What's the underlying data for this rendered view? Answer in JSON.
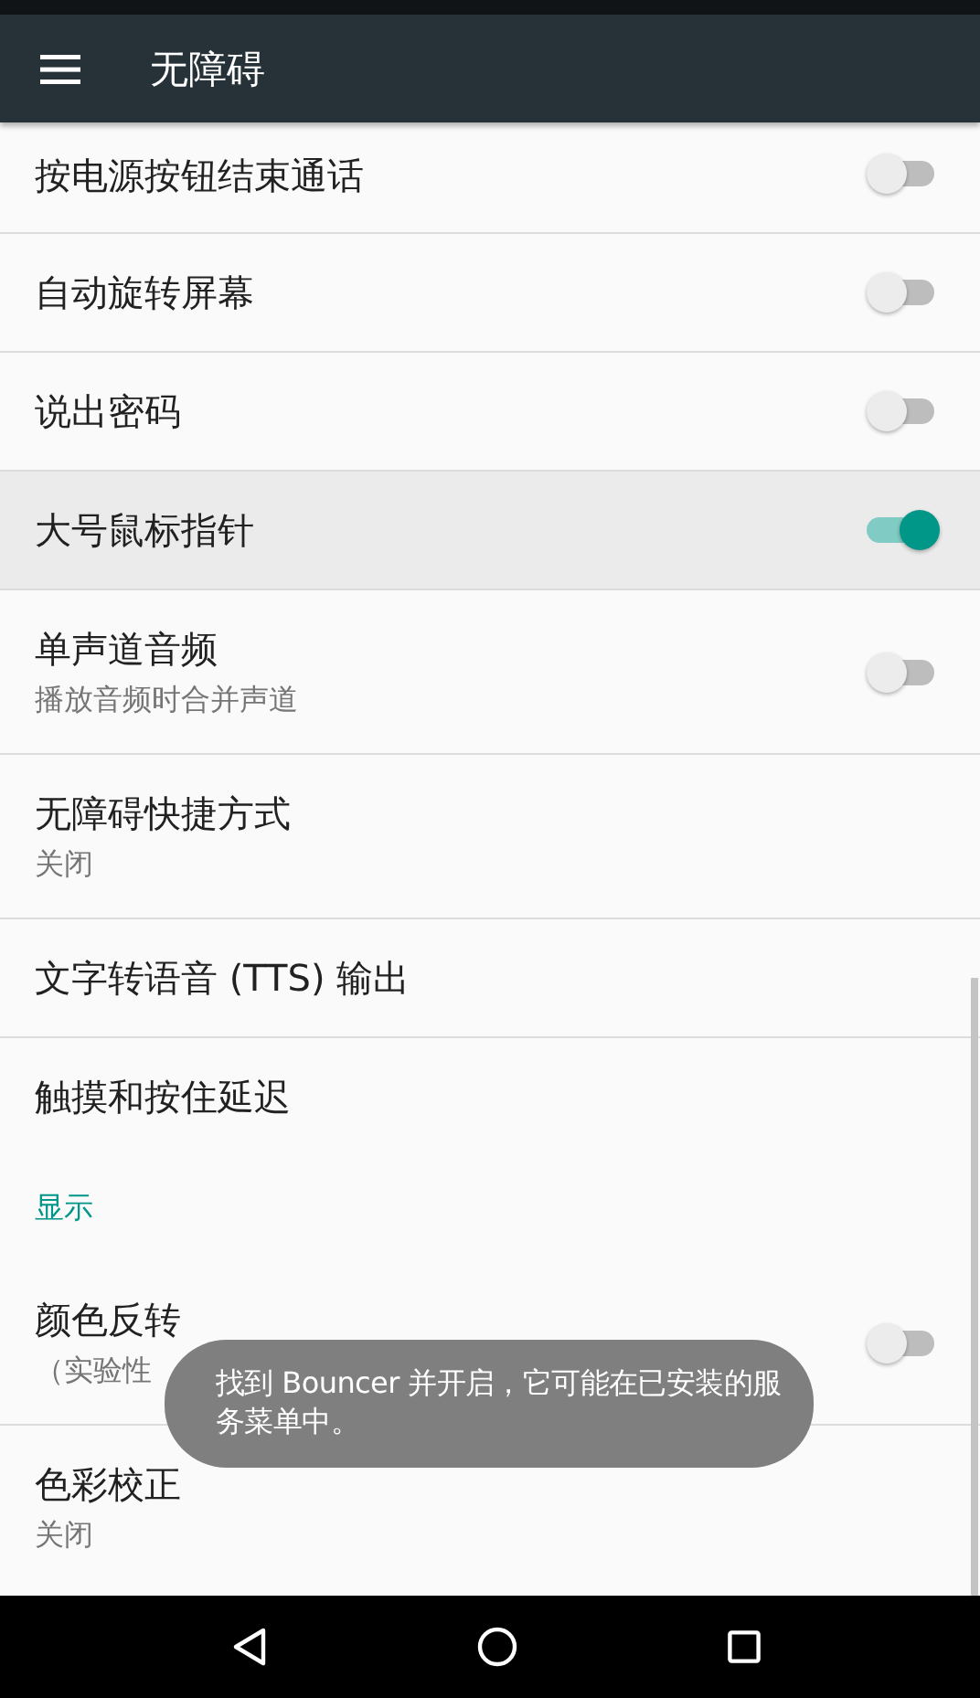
{
  "app_bar": {
    "title": "无障碍"
  },
  "items": [
    {
      "kind": "switch",
      "title": "按电源按钮结束通话",
      "on": false,
      "selected": false
    },
    {
      "kind": "switch",
      "title": "自动旋转屏幕",
      "on": false,
      "selected": false
    },
    {
      "kind": "switch",
      "title": "说出密码",
      "on": false,
      "selected": false
    },
    {
      "kind": "switch",
      "title": "大号鼠标指针",
      "on": true,
      "selected": true
    },
    {
      "kind": "switch",
      "title": "单声道音频",
      "subtitle": "播放音频时合并声道",
      "on": false,
      "selected": false
    },
    {
      "kind": "text",
      "title": "无障碍快捷方式",
      "subtitle": "关闭",
      "selected": false
    },
    {
      "kind": "text",
      "title": "文字转语音 (TTS) 输出",
      "selected": false
    },
    {
      "kind": "text",
      "title": "触摸和按住延迟",
      "selected": false
    },
    {
      "kind": "header",
      "title": "显示"
    },
    {
      "kind": "switch",
      "title": "颜色反转",
      "subtitle": "（实验性",
      "on": false,
      "selected": false
    },
    {
      "kind": "text",
      "title": "色彩校正",
      "subtitle": "关闭",
      "selected": false
    }
  ],
  "toast": {
    "text": "找到 Bouncer 并开启，它可能在已安装的服务菜单中。"
  }
}
